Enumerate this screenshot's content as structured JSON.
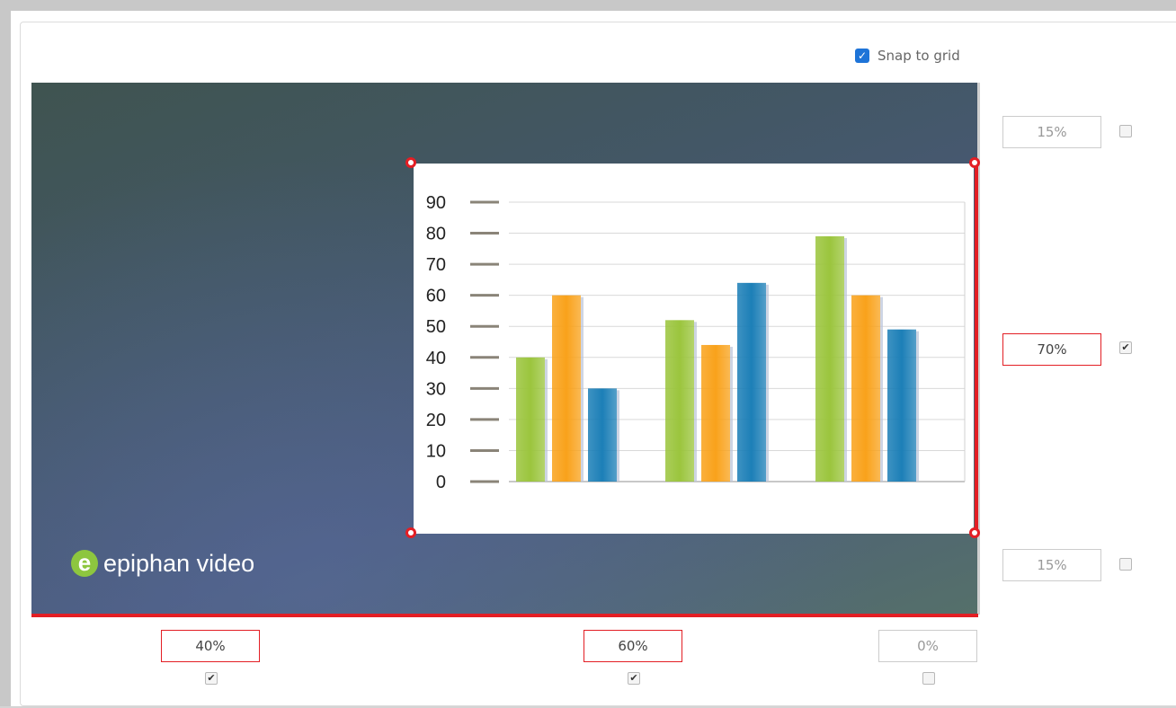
{
  "snap_to_grid": {
    "label": "Snap to grid",
    "checked": true
  },
  "logo": {
    "text": "epiphan video",
    "mark": "e"
  },
  "right_controls": [
    {
      "value": "15%",
      "checked": false,
      "active": false
    },
    {
      "value": "70%",
      "checked": true,
      "active": true
    },
    {
      "value": "15%",
      "checked": false,
      "active": false
    }
  ],
  "bottom_controls": [
    {
      "value": "40%",
      "checked": true,
      "active": true
    },
    {
      "value": "60%",
      "checked": true,
      "active": true
    },
    {
      "value": "0%",
      "checked": false,
      "active": false
    }
  ],
  "colors": {
    "accent_red": "#e31e24",
    "checkbox_blue": "#1e74d8",
    "bar_green": "#9bc53d",
    "bar_orange": "#f9a21b",
    "bar_teal": "#1c7fb7"
  },
  "chart_data": {
    "type": "bar",
    "title": "",
    "xlabel": "",
    "ylabel": "",
    "ylim": [
      0,
      90
    ],
    "yticks": [
      "90",
      "80",
      "70",
      "60",
      "50",
      "40",
      "30",
      "20",
      "10",
      "0"
    ],
    "categories": [
      "",
      "",
      ""
    ],
    "series": [
      {
        "values": [
          40,
          52,
          79
        ],
        "color": "#9bc53d"
      },
      {
        "values": [
          60,
          44,
          60
        ],
        "color": "#f9a21b"
      },
      {
        "values": [
          30,
          64,
          49
        ],
        "color": "#1c7fb7"
      }
    ],
    "grid": true,
    "legend": "none"
  }
}
